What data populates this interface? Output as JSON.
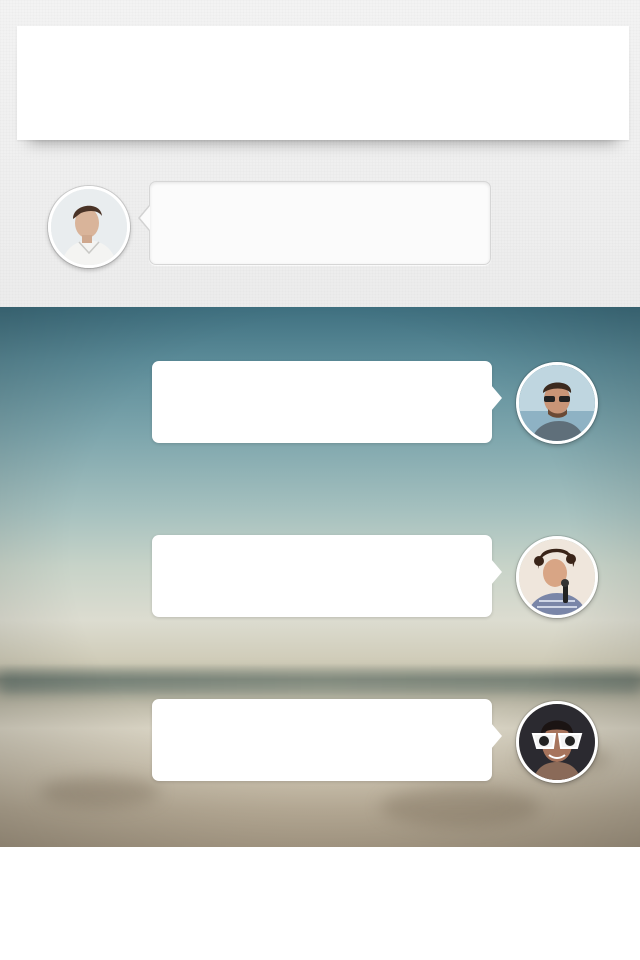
{
  "header": {
    "text": ""
  },
  "messages": [
    {
      "side": "left",
      "text": "",
      "avatar": "user-avatar-1"
    },
    {
      "side": "right",
      "text": "",
      "avatar": "user-avatar-2"
    },
    {
      "side": "right",
      "text": "",
      "avatar": "user-avatar-3"
    },
    {
      "side": "right",
      "text": "",
      "avatar": "user-avatar-4"
    }
  ],
  "colors": {
    "bubble": "#ffffff",
    "background_top": "#f0f0f0",
    "sky": "#3f7080",
    "sand": "#b7ab96"
  }
}
